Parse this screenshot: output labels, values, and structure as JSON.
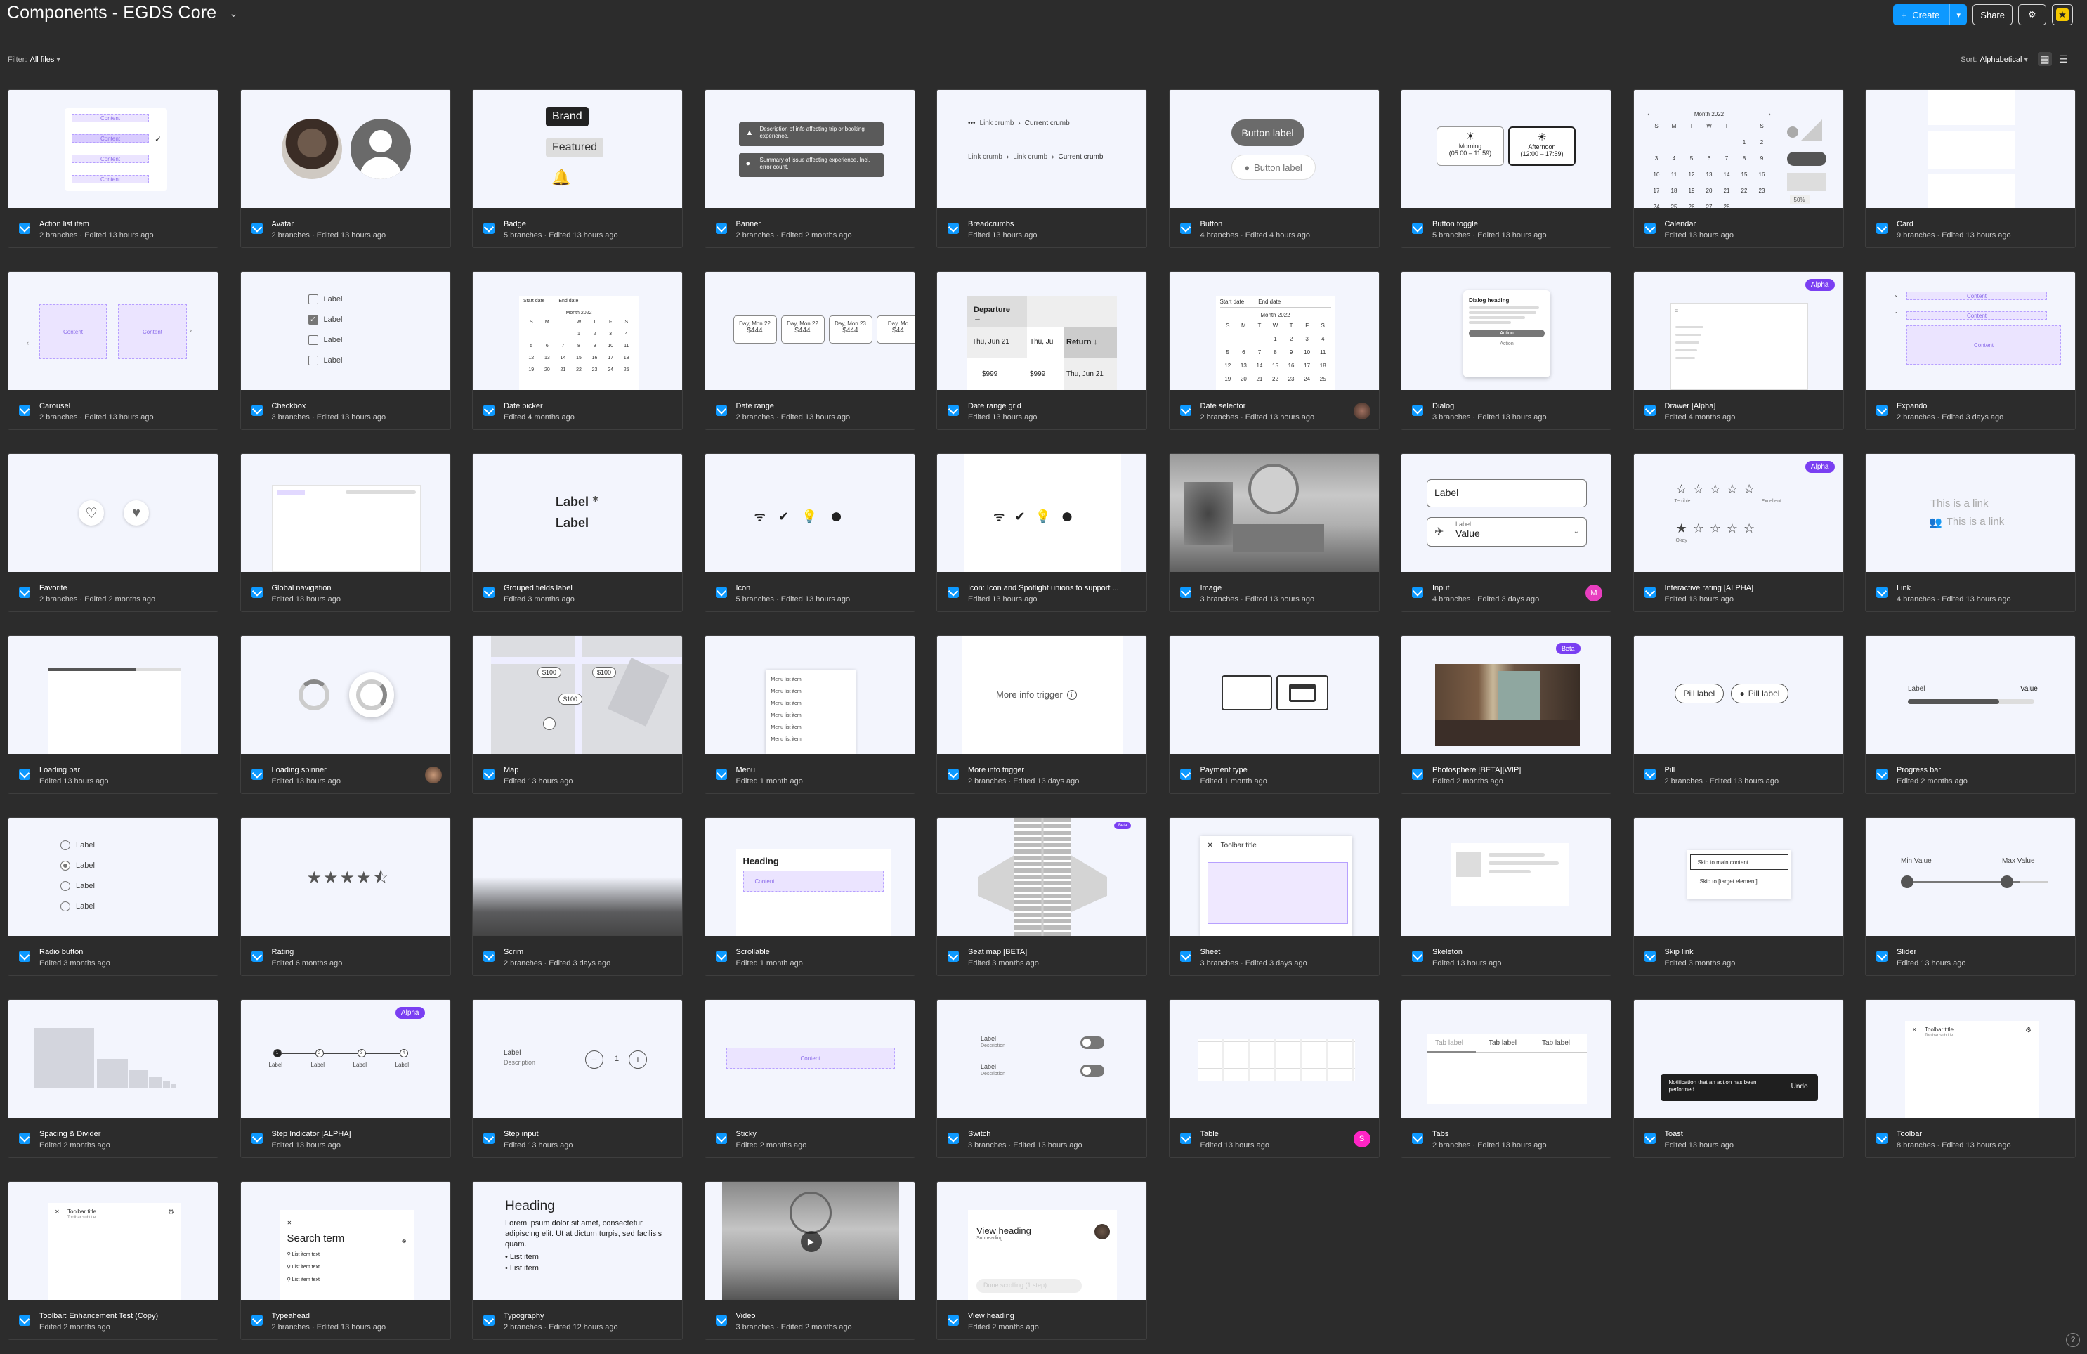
{
  "header": {
    "title": "Components - EGDS Core",
    "create_label": "Create",
    "share_label": "Share"
  },
  "filter": {
    "label": "Filter:",
    "value": "All files"
  },
  "sort": {
    "label": "Sort:",
    "value": "Alphabetical"
  },
  "colors": {
    "accent": "#0d99ff",
    "background": "#2c2c2c",
    "alpha_badge": "#7a3ff2",
    "avatar_m": "#e83ebf",
    "avatar_s": "#ff24c5"
  },
  "cards": [
    {
      "name": "Action list item",
      "sub": "2 branches · Edited 13 hours ago"
    },
    {
      "name": "Avatar",
      "sub": "2 branches · Edited 13 hours ago"
    },
    {
      "name": "Badge",
      "sub": "5 branches · Edited 13 hours ago"
    },
    {
      "name": "Banner",
      "sub": "2 branches · Edited 2 months ago"
    },
    {
      "name": "Breadcrumbs",
      "sub": "Edited 13 hours ago"
    },
    {
      "name": "Button",
      "sub": "4 branches · Edited 4 hours ago"
    },
    {
      "name": "Button toggle",
      "sub": "5 branches · Edited 13 hours ago"
    },
    {
      "name": "Calendar",
      "sub": "Edited 13 hours ago"
    },
    {
      "name": "Card",
      "sub": "9 branches · Edited 13 hours ago"
    },
    {
      "name": "Carousel",
      "sub": "2 branches · Edited 13 hours ago"
    },
    {
      "name": "Checkbox",
      "sub": "3 branches · Edited 13 hours ago"
    },
    {
      "name": "Date picker",
      "sub": "Edited 4 months ago"
    },
    {
      "name": "Date range",
      "sub": "2 branches · Edited 13 hours ago"
    },
    {
      "name": "Date range grid",
      "sub": "Edited 13 hours ago"
    },
    {
      "name": "Date selector",
      "sub": "2 branches · Edited 13 hours ago"
    },
    {
      "name": "Dialog",
      "sub": "3 branches · Edited 13 hours ago"
    },
    {
      "name": "Drawer [Alpha]",
      "sub": "Edited 4 months ago"
    },
    {
      "name": "Expando",
      "sub": "2 branches · Edited 3 days ago"
    },
    {
      "name": "Favorite",
      "sub": "2 branches · Edited 2 months ago"
    },
    {
      "name": "Global navigation",
      "sub": "Edited 13 hours ago"
    },
    {
      "name": "Grouped fields label",
      "sub": "Edited 3 months ago"
    },
    {
      "name": "Icon",
      "sub": "5 branches · Edited 13 hours ago"
    },
    {
      "name": "Icon: Icon and Spotlight unions to support ...",
      "sub": "Edited 13 hours ago"
    },
    {
      "name": "Image",
      "sub": "3 branches · Edited 13 hours ago"
    },
    {
      "name": "Input",
      "sub": "4 branches · Edited 3 days ago"
    },
    {
      "name": "Interactive rating [ALPHA]",
      "sub": "Edited 13 hours ago"
    },
    {
      "name": "Link",
      "sub": "4 branches · Edited 13 hours ago"
    },
    {
      "name": "Loading bar",
      "sub": "Edited 13 hours ago"
    },
    {
      "name": "Loading spinner",
      "sub": "Edited 13 hours ago"
    },
    {
      "name": "Map",
      "sub": "Edited 13 hours ago"
    },
    {
      "name": "Menu",
      "sub": "Edited 1 month ago"
    },
    {
      "name": "More info trigger",
      "sub": "2 branches · Edited 13 days ago"
    },
    {
      "name": "Payment type",
      "sub": "Edited 1 month ago"
    },
    {
      "name": "Photosphere [BETA][WIP]",
      "sub": "Edited 2 months ago"
    },
    {
      "name": "Pill",
      "sub": "2 branches · Edited 13 hours ago"
    },
    {
      "name": "Progress bar",
      "sub": "Edited 2 months ago"
    },
    {
      "name": "Radio button",
      "sub": "Edited 3 months ago"
    },
    {
      "name": "Rating",
      "sub": "Edited 6 months ago"
    },
    {
      "name": "Scrim",
      "sub": "2 branches · Edited 3 days ago"
    },
    {
      "name": "Scrollable",
      "sub": "Edited 1 month ago"
    },
    {
      "name": "Seat map [BETA]",
      "sub": "Edited 3 months ago"
    },
    {
      "name": "Sheet",
      "sub": "3 branches · Edited 3 days ago"
    },
    {
      "name": "Skeleton",
      "sub": "Edited 13 hours ago"
    },
    {
      "name": "Skip link",
      "sub": "Edited 3 months ago"
    },
    {
      "name": "Slider",
      "sub": "Edited 13 hours ago"
    },
    {
      "name": "Spacing & Divider",
      "sub": "Edited 2 months ago"
    },
    {
      "name": "Step Indicator [ALPHA]",
      "sub": "Edited 13 hours ago"
    },
    {
      "name": "Step input",
      "sub": "Edited 13 hours ago"
    },
    {
      "name": "Sticky",
      "sub": "Edited 2 months ago"
    },
    {
      "name": "Switch",
      "sub": "3 branches · Edited 13 hours ago"
    },
    {
      "name": "Table",
      "sub": "Edited 13 hours ago"
    },
    {
      "name": "Tabs",
      "sub": "2 branches · Edited 13 hours ago"
    },
    {
      "name": "Toast",
      "sub": "Edited 13 hours ago"
    },
    {
      "name": "Toolbar",
      "sub": "8 branches · Edited 13 hours ago"
    },
    {
      "name": "Toolbar: Enhancement Test (Copy)",
      "sub": "Edited 2 months ago"
    },
    {
      "name": "Typeahead",
      "sub": "2 branches · Edited 13 hours ago"
    },
    {
      "name": "Typography",
      "sub": "2 branches · Edited 12 hours ago"
    },
    {
      "name": "Video",
      "sub": "3 branches · Edited 2 months ago"
    },
    {
      "name": "View heading",
      "sub": "Edited 2 months ago"
    }
  ],
  "thumbs": {
    "action_list": [
      "Content",
      "Content",
      "Content",
      "Content"
    ],
    "badge": {
      "brand": "Brand",
      "featured": "Featured"
    },
    "banner": [
      "Description of info affecting trip or booking experience.",
      "Summary of issue affecting experience. Incl. error count."
    ],
    "breadcrumbs": {
      "link": "Link crumb",
      "current": "Current crumb"
    },
    "button": {
      "primary": "Button label",
      "secondary": "Button label"
    },
    "button_toggle": [
      {
        "label": "Morning",
        "time": "(05:00 – 11:59)"
      },
      {
        "label": "Afternoon",
        "time": "(12:00 – 17:59)"
      }
    ],
    "calendar": {
      "month": "Month 2022",
      "days": [
        "S",
        "M",
        "T",
        "W",
        "T",
        "F",
        "S"
      ],
      "pct": "50%"
    },
    "carousel": {
      "content": "Content"
    },
    "checkbox": [
      "Label",
      "Label",
      "Label",
      "Label"
    ],
    "date_picker": {
      "start": "Start date",
      "end": "End date",
      "month": "Month 2022"
    },
    "date_range": [
      {
        "d": "Day, Mon 22",
        "p": "$444"
      },
      {
        "d": "Day, Mon 22",
        "p": "$444"
      },
      {
        "d": "Day, Mon 23",
        "p": "$444"
      },
      {
        "d": "Day, Mo",
        "p": "$44"
      }
    ],
    "date_range_grid": {
      "departure": "Departure",
      "return": "Return",
      "d1": "Thu, Jun 21",
      "d2": "Thu, Ju",
      "d3": "Thu, Jun 21",
      "p1": "$999",
      "p2": "$999"
    },
    "date_selector": {
      "start": "Start date",
      "end": "End date",
      "month": "Month 2022"
    },
    "dialog": {
      "heading": "Dialog heading",
      "action": "Action",
      "secondary": "Action"
    },
    "drawer": {
      "badge": "Alpha"
    },
    "expando": {
      "content": "Content"
    },
    "grouped_label": {
      "label1": "Label",
      "label2": "Label"
    },
    "input": {
      "label": "Label",
      "sublabel": "Label",
      "value": "Value"
    },
    "interactive_rating": {
      "badge": "Alpha",
      "low": "Terrible",
      "high": "Excellent",
      "mid": "Okay"
    },
    "link": {
      "link1": "This is a link",
      "link2": "This is a link"
    },
    "map": {
      "prices": [
        "$100",
        "$100",
        "$100"
      ]
    },
    "menu": [
      "Menu list item",
      "Menu list item",
      "Menu list item",
      "Menu list item",
      "Menu list item",
      "Menu list item"
    ],
    "more_info": "More info trigger",
    "photosphere_badge": "Beta",
    "pill": {
      "p1": "Pill label",
      "p2": "Pill label"
    },
    "progress": {
      "label": "Label",
      "value": "Value",
      "fraction": 0.72
    },
    "radio": [
      "Label",
      "Label",
      "Label",
      "Label"
    ],
    "scrollable": {
      "heading": "Heading",
      "content": "Content"
    },
    "seatmap_badge": "Beta",
    "sheet": {
      "title": "Toolbar title"
    },
    "skip_link": {
      "main": "Skip to main content",
      "target": "Skip to [target element]"
    },
    "slider": {
      "min": "Min Value",
      "max": "Max Value"
    },
    "step_indicator": {
      "badge": "Alpha",
      "labels": [
        "Label",
        "Label",
        "Label",
        "Label"
      ]
    },
    "step_input": {
      "label": "Label",
      "desc": "Description",
      "value": "1"
    },
    "sticky": {
      "content": "Content"
    },
    "switch": [
      {
        "label": "Label",
        "desc": "Description"
      },
      {
        "label": "Label",
        "desc": "Description"
      }
    ],
    "tabs": [
      "Tab label",
      "Tab label",
      "Tab label"
    ],
    "toast": {
      "text": "Notification that an action has been performed.",
      "action": "Undo"
    },
    "toolbar": {
      "title": "Toolbar title",
      "sub": "Toolbar subtitle"
    },
    "toolbar_copy": {
      "title": "Toolbar title",
      "sub": "Toolbar subtitle"
    },
    "typeahead": {
      "term": "Search term",
      "items": [
        "List item text",
        "List item text",
        "List item text"
      ]
    },
    "typography": {
      "heading": "Heading",
      "body": "Lorem ipsum dolor sit amet, consectetur adipiscing elit. Ut at dictum turpis, sed facilisis quam.",
      "items": [
        "List item",
        "List item"
      ]
    },
    "view_heading": {
      "title": "View heading",
      "sub": "Subheading",
      "footer": "Done scrolling (1 step)"
    }
  }
}
